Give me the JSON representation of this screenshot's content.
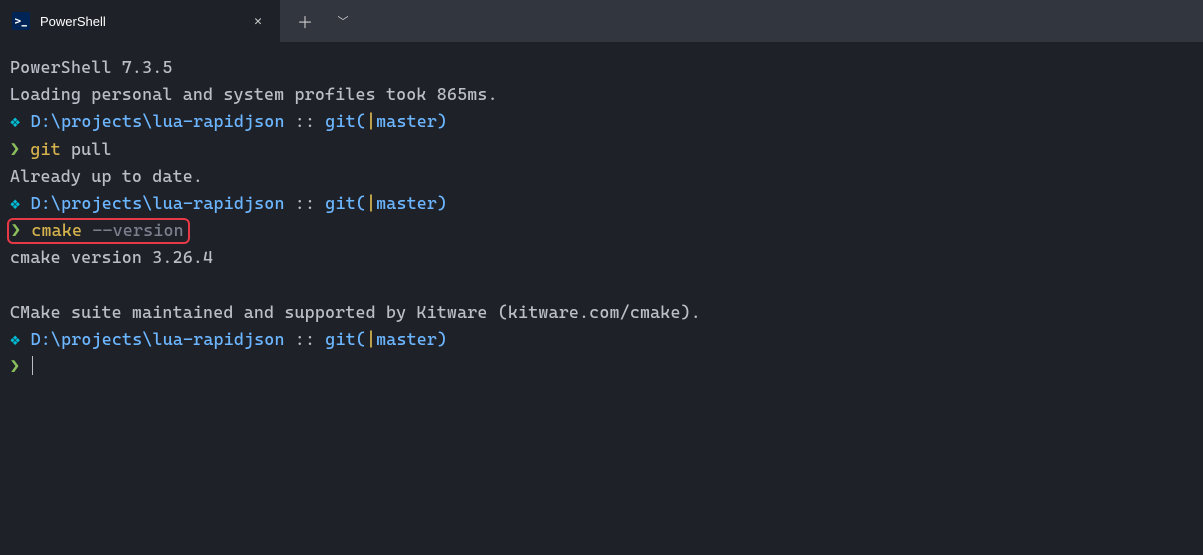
{
  "title_bar": {
    "tab_title": "PowerShell",
    "close_glyph": "✕",
    "add_glyph": "＋",
    "dropdown_glyph": "﹀"
  },
  "terminal": {
    "line1": "PowerShell 7.3.5",
    "line2": "Loading personal and system profiles took 865ms.",
    "win_glyph": "❖",
    "path": "D:\\projects\\lua-rapidjson",
    "sep": " :: ",
    "git_label": "git",
    "paren_open": "(",
    "branch_glyph": "|",
    "branch": "master",
    "paren_close": ")",
    "arrow": "❯",
    "cmd1_a": "git",
    "cmd1_b": " pull",
    "out1": "Already up to date.",
    "cmd2_a": "cmake",
    "cmd2_b": " --version",
    "out2": "cmake version 3.26.4",
    "out3": "CMake suite maintained and supported by Kitware (kitware.com/cmake)."
  }
}
